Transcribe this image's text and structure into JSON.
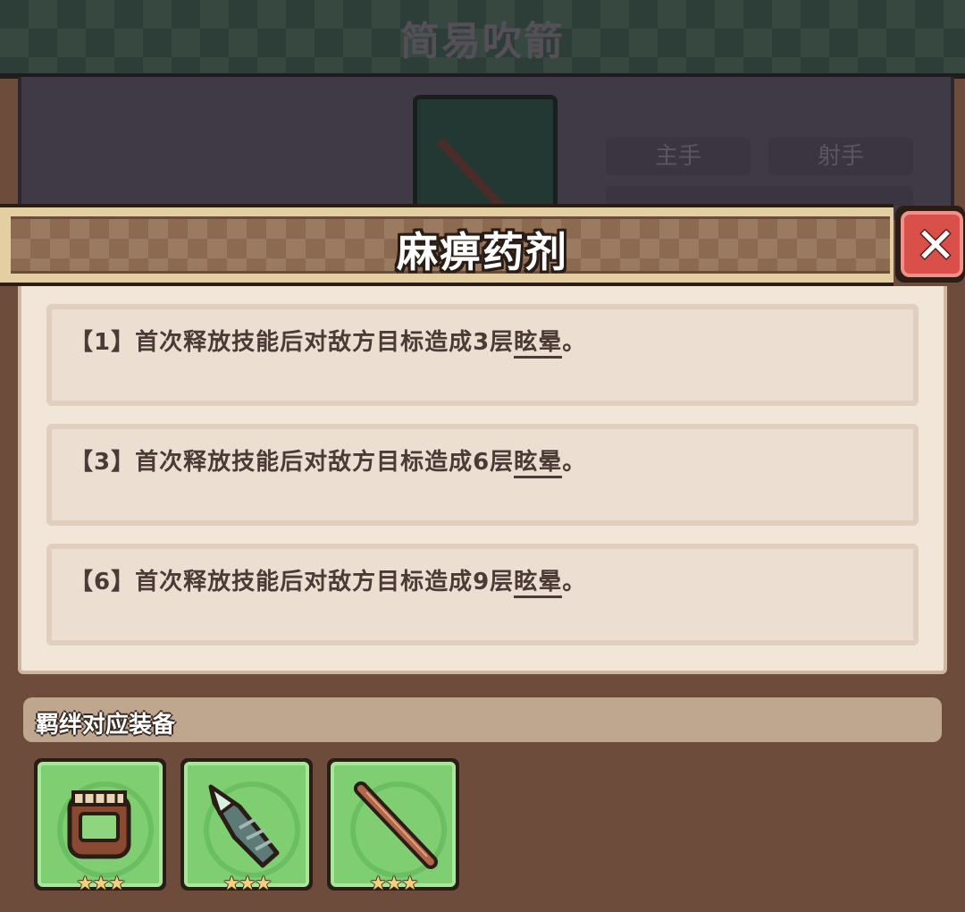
{
  "background": {
    "title": "简易吹箭",
    "tags": [
      "主手",
      "射手"
    ]
  },
  "popup": {
    "title": "麻痹药剂",
    "close_icon": "close-icon"
  },
  "bonuses": [
    {
      "count": "【1】",
      "text": "首次释放技能后对敌方目标造成3层",
      "effect": "眩晕",
      "end": "。"
    },
    {
      "count": "【3】",
      "text": "首次释放技能后对敌方目标造成6层",
      "effect": "眩晕",
      "end": "。"
    },
    {
      "count": "【6】",
      "text": "首次释放技能后对敌方目标造成9层",
      "effect": "眩晕",
      "end": "。"
    }
  ],
  "set_equipment": {
    "label": "羁绊对应装备",
    "items": [
      {
        "icon": "belt-icon",
        "stars": "★★★",
        "star_count": 3
      },
      {
        "icon": "feather-blade-icon",
        "stars": "★★★",
        "star_count": 3
      },
      {
        "icon": "blowpipe-icon",
        "stars": "★★★",
        "star_count": 3
      }
    ]
  },
  "colors": {
    "banner_bg": "#8b6a51",
    "panel_bg": "#f2e6d8",
    "close_red": "#d9504a",
    "slot_green": "#7fcf72",
    "text_dark": "#4b3a35"
  }
}
